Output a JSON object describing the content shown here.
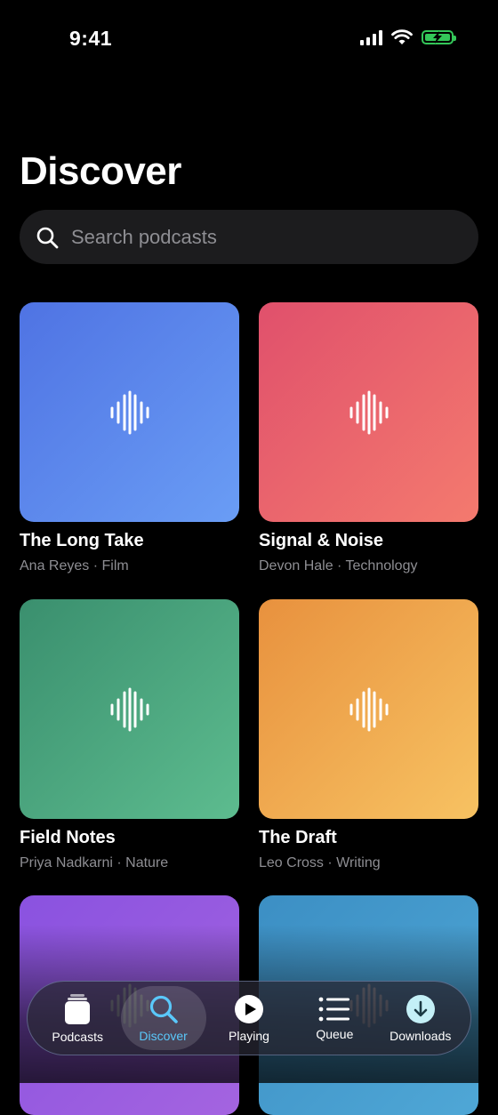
{
  "status": {
    "time": "9:41"
  },
  "page": {
    "title": "Discover"
  },
  "search": {
    "placeholder": "Search podcasts"
  },
  "podcasts": [
    {
      "title": "The Long Take",
      "subtitle": "Ana Reyes · Film",
      "colors": [
        "#4f73e3",
        "#6a9df5"
      ]
    },
    {
      "title": "Signal & Noise",
      "subtitle": "Devon Hale · Technology",
      "colors": [
        "#e0506c",
        "#f47a6e"
      ]
    },
    {
      "title": "Field Notes",
      "subtitle": "Priya Nadkarni · Nature",
      "colors": [
        "#3a8f6e",
        "#5dbc8f"
      ]
    },
    {
      "title": "The Draft",
      "subtitle": "Leo Cross · Writing",
      "colors": [
        "#e8913e",
        "#f7c262"
      ]
    },
    {
      "title": "",
      "subtitle": "",
      "colors": [
        "#8a52e0",
        "#a464e0"
      ]
    },
    {
      "title": "",
      "subtitle": "",
      "colors": [
        "#3c8fc4",
        "#4fa7d6"
      ]
    }
  ],
  "tabs": [
    {
      "label": "Podcasts",
      "icon": "podcasts-stack-icon",
      "active": false
    },
    {
      "label": "Discover",
      "icon": "search-icon",
      "active": true
    },
    {
      "label": "Playing",
      "icon": "play-circle-icon",
      "active": false
    },
    {
      "label": "Queue",
      "icon": "list-icon",
      "active": false
    },
    {
      "label": "Downloads",
      "icon": "download-circle-icon",
      "active": false
    }
  ],
  "colors": {
    "accent": "#5ac8fa",
    "battery": "#34c759",
    "subtitle": "#8e8e93",
    "search_bg": "#1c1c1e"
  }
}
